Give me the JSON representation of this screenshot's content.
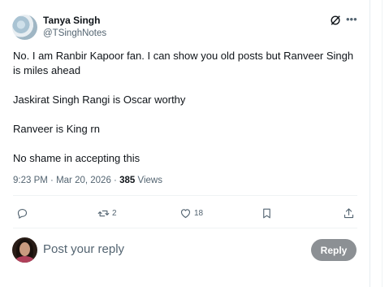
{
  "author": {
    "name": "Tanya Singh",
    "handle": "@TSinghNotes"
  },
  "post": {
    "paragraphs": [
      "No. I am Ranbir Kapoor fan. I can show you old posts but Ranveer Singh is miles ahead",
      "Jaskirat Singh Rangi is Oscar worthy",
      "Ranveer is King rn",
      "No shame in accepting this"
    ],
    "time": "9:23 PM",
    "separator": "·",
    "date": "Mar 20, 2026",
    "views_count": "385",
    "views_label": "Views"
  },
  "actions": {
    "reply_icon": "reply-icon",
    "repost_icon": "repost-icon",
    "repost_count": "2",
    "like_icon": "heart-icon",
    "like_count": "18",
    "bookmark_icon": "bookmark-icon",
    "share_icon": "share-icon"
  },
  "header_icons": {
    "grok": "grok-icon",
    "more": "more-icon"
  },
  "reply": {
    "placeholder": "Post your reply",
    "button_label": "Reply"
  },
  "colors": {
    "text": "#0f1419",
    "secondary": "#536471",
    "reply_button_bg": "#8c9094"
  }
}
